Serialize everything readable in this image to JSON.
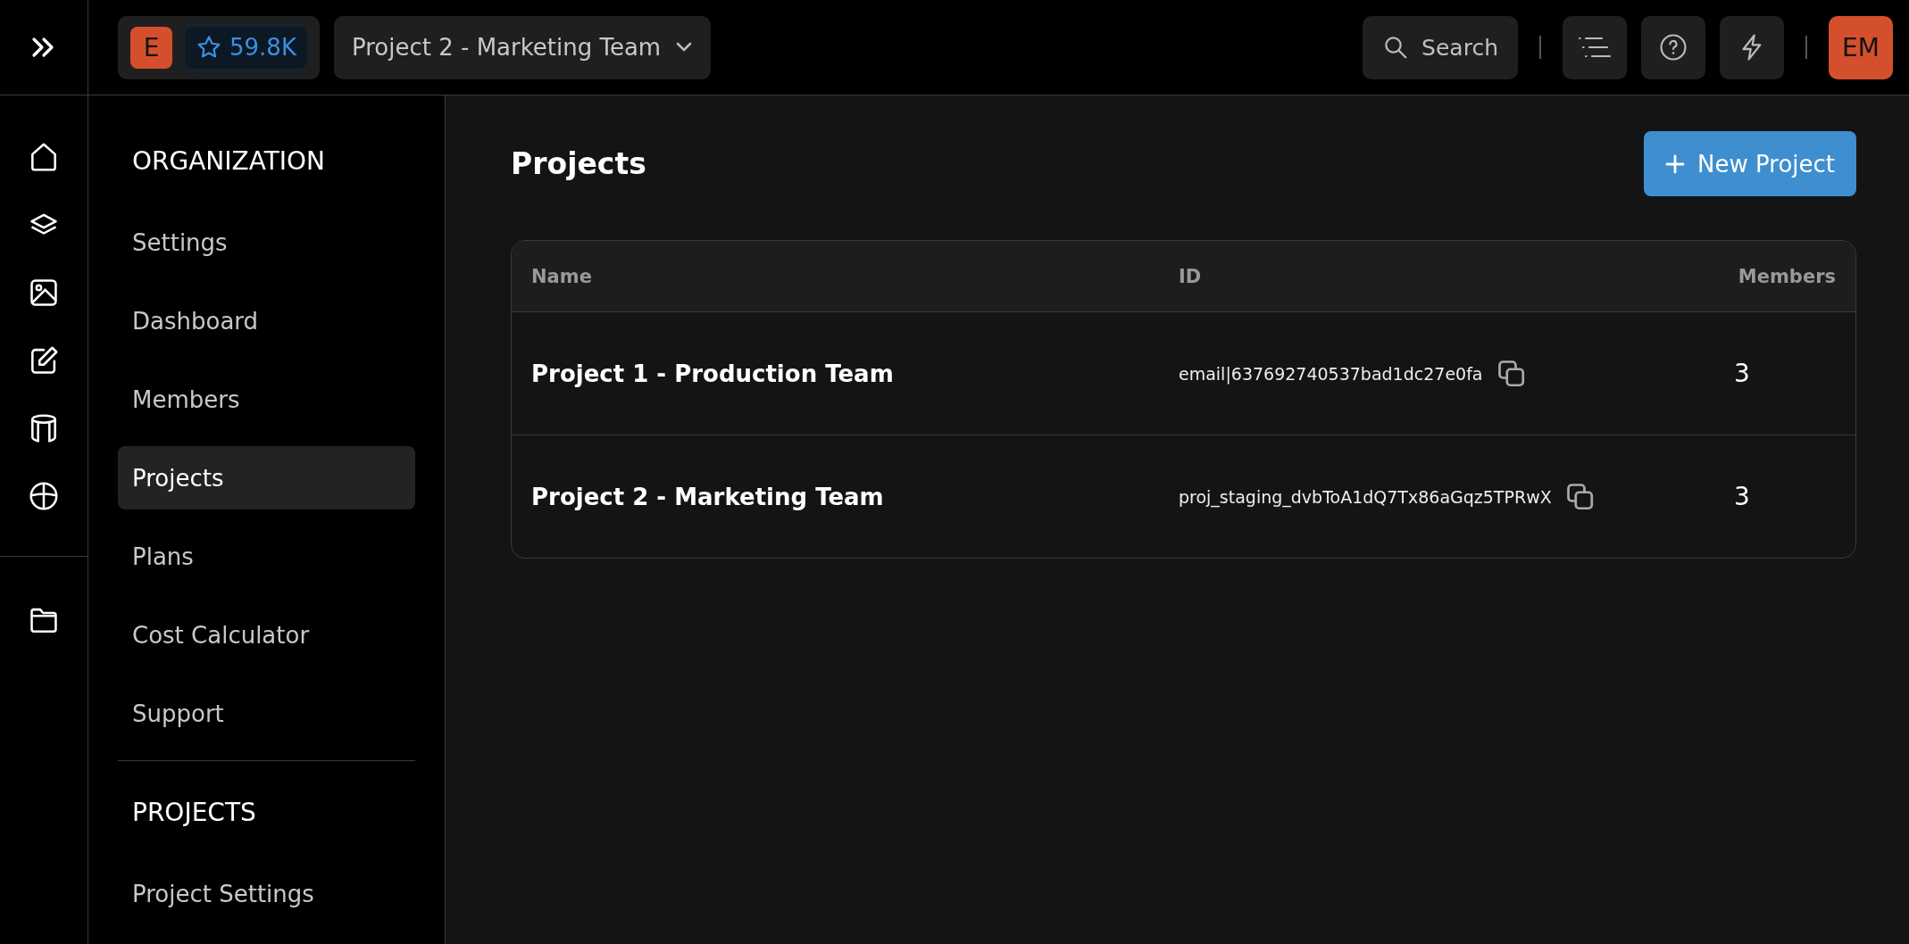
{
  "topbar": {
    "org_initial": "E",
    "stars": "59.8K",
    "project": "Project 2 - Marketing Team",
    "search": {
      "label": "Search"
    },
    "user_initials": "EM"
  },
  "sidebar": {
    "sections": [
      {
        "title": "ORGANIZATION",
        "items": [
          {
            "label": "Settings",
            "selected": false
          },
          {
            "label": "Dashboard",
            "selected": false
          },
          {
            "label": "Members",
            "selected": false
          },
          {
            "label": "Projects",
            "selected": true
          },
          {
            "label": "Plans",
            "selected": false
          },
          {
            "label": "Cost Calculator",
            "selected": false
          },
          {
            "label": "Support",
            "selected": false
          }
        ]
      },
      {
        "title": "PROJECTS",
        "items": [
          {
            "label": "Project Settings",
            "selected": false
          }
        ]
      }
    ]
  },
  "main": {
    "title": "Projects",
    "new_button": "New Project",
    "table": {
      "columns": [
        "Name",
        "ID",
        "Members"
      ],
      "rows": [
        {
          "name": "Project 1 - Production Team",
          "id": "email|637692740537bad1dc27e0fa",
          "members": "3"
        },
        {
          "name": "Project 2 - Marketing Team",
          "id": "proj_staging_dvbToA1dQ7Tx86aGqz5TPRwX",
          "members": "3"
        }
      ]
    }
  }
}
